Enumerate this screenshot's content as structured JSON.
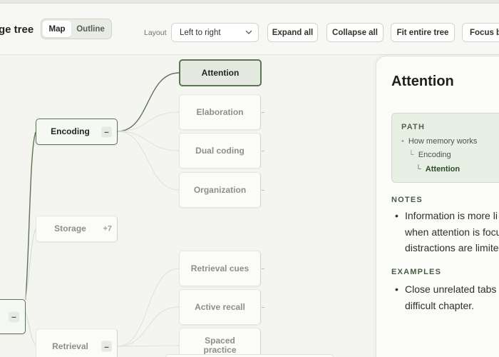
{
  "header": {
    "title": "ge tree",
    "view_toggle": {
      "map": "Map",
      "outline": "Outline"
    },
    "layout_label": "Layout",
    "layout_value": "Left to right",
    "buttons": {
      "expand_all": "Expand all",
      "collapse_all": "Collapse all",
      "fit_tree": "Fit entire tree",
      "focus": "Focus b"
    }
  },
  "tree": {
    "root_toggle": "–",
    "encoding": {
      "label": "Encoding",
      "toggle": "–"
    },
    "storage": {
      "label": "Storage",
      "count": "+7"
    },
    "retrieval": {
      "label": "Retrieval",
      "toggle": "–"
    },
    "encoding_children": [
      "Attention",
      "Elaboration",
      "Dual coding",
      "Organization"
    ],
    "retrieval_children": [
      "Retrieval cues",
      "Active recall",
      "Spaced practice"
    ]
  },
  "panel": {
    "title": "Attention",
    "path_label": "PATH",
    "path": [
      "How memory works",
      "Encoding",
      "Attention"
    ],
    "notes_label": "NOTES",
    "notes_lines": [
      "Information is more li",
      "when attention is focu",
      "distractions are limite"
    ],
    "examples_label": "EXAMPLES",
    "examples_lines": [
      "Close unrelated tabs",
      "difficult chapter."
    ]
  },
  "colors": {
    "accent": "#5c7453",
    "selected_fill": "#e3e9df",
    "background": "#f4f5f1"
  }
}
